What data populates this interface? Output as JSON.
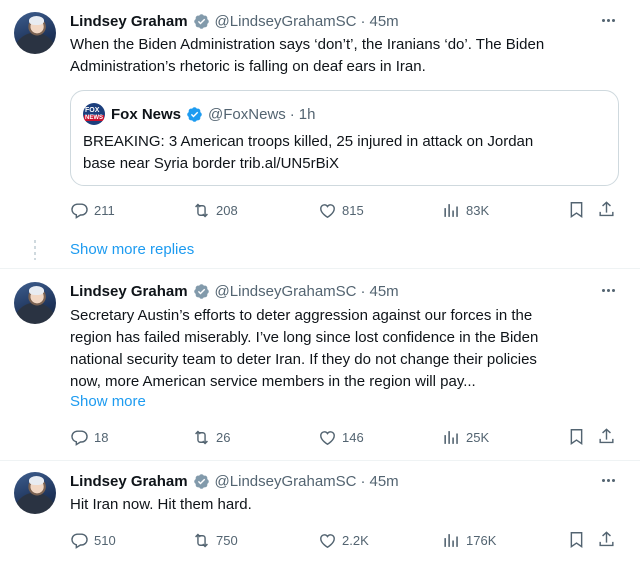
{
  "tweets": [
    {
      "name": "Lindsey Graham",
      "handle": "@LindseyGrahamSC",
      "dot": "·",
      "time": "45m",
      "text_lines": [
        "When the Biden Administration says ‘don’t’, the Iranians ‘do’. The Biden",
        "Administration’s rhetoric is falling on deaf ears in Iran."
      ],
      "quote": {
        "name": "Fox News",
        "handle": "@FoxNews",
        "dot": "·",
        "time": "1h",
        "text_lines": [
          "BREAKING: 3 American troops killed, 25 injured in attack on Jordan",
          "base near Syria border trib.al/UN5rBiX"
        ]
      },
      "replies": "211",
      "reposts": "208",
      "likes": "815",
      "views": "83K"
    },
    {
      "name": "Lindsey Graham",
      "handle": "@LindseyGrahamSC",
      "dot": "·",
      "time": "45m",
      "text_lines": [
        "Secretary Austin’s efforts to deter aggression against our forces in the",
        "region has failed miserably. I’ve long since lost confidence in the Biden",
        "national security team to deter Iran. If they do not change their policies",
        "now, more American service members in the region will pay..."
      ],
      "show_more": "Show more",
      "replies": "18",
      "reposts": "26",
      "likes": "146",
      "views": "25K"
    },
    {
      "name": "Lindsey Graham",
      "handle": "@LindseyGrahamSC",
      "dot": "·",
      "time": "45m",
      "text_lines": [
        "Hit Iran now. Hit them hard."
      ],
      "replies": "510",
      "reposts": "750",
      "likes": "2.2K",
      "views": "176K"
    }
  ],
  "show_more_replies": "Show more replies",
  "colors": {
    "accent": "#1d9bf0",
    "text": "#0f1419",
    "muted": "#536471",
    "border": "#cfd9de"
  },
  "icons": [
    "more-icon",
    "verified-badge-icon",
    "reply-icon",
    "repost-icon",
    "like-icon",
    "views-icon",
    "bookmark-icon",
    "share-icon"
  ]
}
